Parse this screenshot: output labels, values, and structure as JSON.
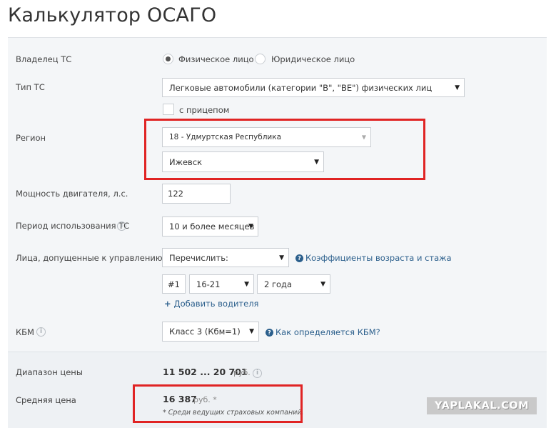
{
  "page": {
    "title": "Калькулятор ОСАГО"
  },
  "owner": {
    "label": "Владелец ТС",
    "options": [
      "Физическое лицо",
      "Юридическое лицо"
    ],
    "selected": 0
  },
  "vehicle_type": {
    "label": "Тип ТС",
    "value": "Легковые автомобили (категории \"B\", \"BE\") физических лиц",
    "trailer_label": "с прицепом"
  },
  "region": {
    "label": "Регион",
    "region_value": "18 - Удмуртская Республика",
    "city_value": "Ижевск"
  },
  "power": {
    "label": "Мощность двигателя, л.с.",
    "value": "122"
  },
  "period": {
    "label": "Период использования ТС",
    "value": "10 и более месяцев"
  },
  "drivers": {
    "label": "Лица, допущенные к управлению",
    "mode_value": "Перечислить:",
    "coef_link": "Коэффициенты возраста и стажа",
    "row": {
      "number": "#1",
      "age": "16-21",
      "experience": "2 года"
    },
    "add_label": "Добавить водителя"
  },
  "kbm": {
    "label": "КБМ",
    "value": "Класс 3 (Кбм=1)",
    "link": "Как определяется КБМ?"
  },
  "results": {
    "range_label": "Диапазон цены",
    "range_value": "11 502 ... 20 701",
    "range_unit": "руб.",
    "avg_label": "Средняя цена",
    "avg_value": "16 387",
    "avg_unit": "руб. *",
    "note": "* Среди ведущих страховых компаний."
  },
  "watermark": "YAPLAKAL.COM",
  "colors": {
    "accent_red": "#e02424",
    "link_blue": "#2b5f8c"
  }
}
